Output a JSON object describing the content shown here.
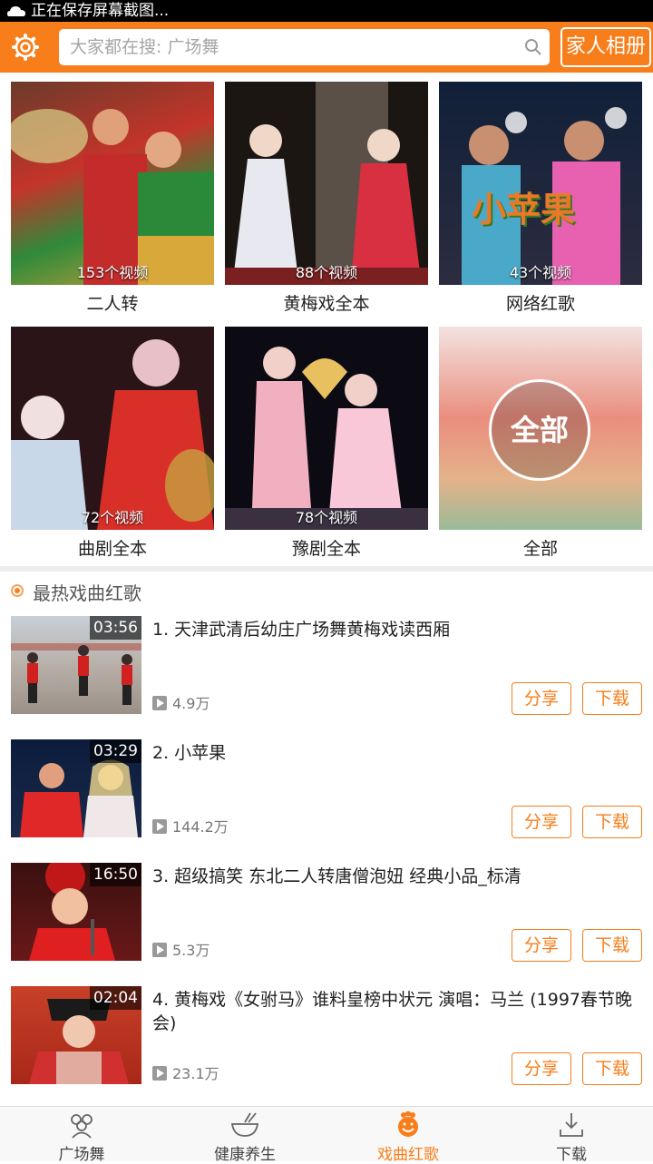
{
  "status_bar": {
    "text": "正在保存屏幕截图..."
  },
  "topbar": {
    "search_placeholder": "大家都在搜: 广场舞",
    "album_button": "家人相册",
    "accent": "#f77e1b"
  },
  "categories": [
    {
      "label": "二人转",
      "count": "153个视频"
    },
    {
      "label": "黄梅戏全本",
      "count": "88个视频"
    },
    {
      "label": "网络红歌",
      "count": "43个视频",
      "overlay": "小苹果"
    },
    {
      "label": "曲剧全本",
      "count": "72个视频"
    },
    {
      "label": "豫剧全本",
      "count": "78个视频"
    },
    {
      "label": "全部",
      "badge": "全部"
    }
  ],
  "section": {
    "title": "最热戏曲红歌"
  },
  "videos": [
    {
      "title": "1. 天津武清后幼庄广场舞黄梅戏读西厢",
      "duration": "03:56",
      "plays": "4.9万",
      "share": "分享",
      "download": "下载"
    },
    {
      "title": "2. 小苹果",
      "duration": "03:29",
      "plays": "144.2万",
      "share": "分享",
      "download": "下载"
    },
    {
      "title": "3. 超级搞笑 东北二人转唐僧泡妞 经典小品_标清",
      "duration": "16:50",
      "plays": "5.3万",
      "share": "分享",
      "download": "下载"
    },
    {
      "title": "4. 黄梅戏《女驸马》谁料皇榜中状元 演唱：马兰 (1997春节晚会)",
      "duration": "02:04",
      "plays": "23.1万",
      "share": "分享",
      "download": "下载"
    }
  ],
  "tabs": [
    {
      "label": "广场舞",
      "icon": "people-icon"
    },
    {
      "label": "健康养生",
      "icon": "bowl-icon"
    },
    {
      "label": "戏曲红歌",
      "icon": "opera-icon",
      "active": true
    },
    {
      "label": "下载",
      "icon": "download-icon"
    }
  ]
}
